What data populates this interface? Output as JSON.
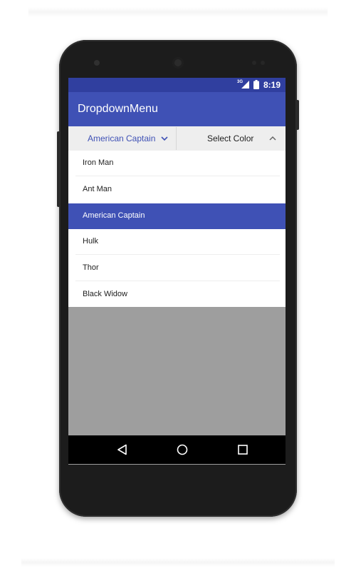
{
  "status_bar": {
    "network": "3G",
    "time": "8:19"
  },
  "app_bar": {
    "title": "DropdownMenu",
    "color": "#3f51b5"
  },
  "dropdowns": {
    "hero": {
      "selected": "American Captain",
      "icon": "chevron-down-icon"
    },
    "color": {
      "selected": "Select Color",
      "icon": "chevron-up-icon"
    }
  },
  "menu": {
    "items": [
      {
        "label": "Iron Man",
        "selected": false
      },
      {
        "label": "Ant Man",
        "selected": false
      },
      {
        "label": "American Captain",
        "selected": true
      },
      {
        "label": "Hulk",
        "selected": false
      },
      {
        "label": "Thor",
        "selected": false
      },
      {
        "label": "Black Widow",
        "selected": false
      }
    ]
  },
  "nav_bar": {
    "buttons": [
      "back-icon",
      "home-icon",
      "recents-icon"
    ]
  }
}
